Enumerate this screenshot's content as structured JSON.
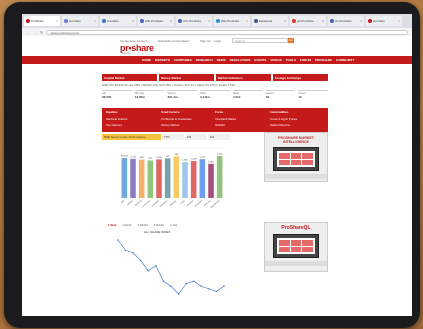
{
  "browser": {
    "tabs": [
      {
        "label": "ProShare",
        "favicon_color": "#c41a1a",
        "active": true
      },
      {
        "label": "proshare",
        "favicon_color": "#6a7bd0",
        "active": false
      },
      {
        "label": "proshare",
        "favicon_color": "#3a74c9",
        "active": false
      },
      {
        "label": "(39) Proshare",
        "favicon_color": "#3f65b8",
        "active": false
      },
      {
        "label": "(27) Proshare",
        "favicon_color": "#3f65b8",
        "active": false
      },
      {
        "label": "(50) Proshare",
        "favicon_color": "#2c8fd8",
        "active": false
      },
      {
        "label": "Facebook",
        "favicon_color": "#3b5998",
        "active": false
      },
      {
        "label": "(2) Proshare",
        "favicon_color": "#d93030",
        "active": false
      },
      {
        "label": "(1) Proshare",
        "favicon_color": "#3f65b8",
        "active": false
      },
      {
        "label": "proshare",
        "favicon_color": "#c41a1a",
        "active": false
      }
    ],
    "close_glyph": "×",
    "url": "www.proshareng.com"
  },
  "site": {
    "top_links": [
      "Create Free Account",
      "Subscribe to Newsletter",
      "Sign Up",
      "Login"
    ],
    "search_placeholder": "Search",
    "search_button": "Go",
    "logo": "pr•share",
    "logo_sub": "Nigeria",
    "nav": [
      "HOME",
      "MARKETS",
      "COMPANIES",
      "RESEARCH",
      "NEWS",
      "REGULATORS",
      "EVENTS",
      "VIDEOS",
      "TOOLS",
      "FORUM",
      "PROSHARE",
      "COMMUNITY"
    ]
  },
  "sub_blocks": [
    "Capital Market",
    "Money Market",
    "Market Indicators",
    "Foreign Exchange"
  ],
  "ticker": "NSE ASI 38,230.12 ▲0.45%  |  Market Cap N13.45tn  |  Volume 321.4m  |  Value N3.21bn  |  Deals 4,512",
  "mini_stats": [
    {
      "label": "ASI",
      "value": "38,230"
    },
    {
      "label": "Mkt Cap",
      "value": "13.45tn"
    },
    {
      "label": "Volume",
      "value": "321.4m"
    },
    {
      "label": "Value",
      "value": "3.21bn"
    },
    {
      "label": "Deals",
      "value": "4,512"
    },
    {
      "label": "Gainers",
      "value": "18"
    },
    {
      "label": "Losers",
      "value": "12"
    }
  ],
  "redbox": [
    {
      "text": "Equities",
      "h": true
    },
    {
      "text": "Fixed Income",
      "h": true
    },
    {
      "text": "Forex",
      "h": true
    },
    {
      "text": "Commodities",
      "h": true
    },
    {
      "text": "Sectoral Indices",
      "h": false
    },
    {
      "text": "FG Bonds & Treasuries",
      "h": false
    },
    {
      "text": "Interbank Rates",
      "h": false
    },
    {
      "text": "Crude & Agric Prices",
      "h": false
    },
    {
      "text": "Top Gainers",
      "h": false
    },
    {
      "text": "Money Market",
      "h": false
    },
    {
      "text": "NAFEX",
      "h": false
    },
    {
      "text": "Market Reports",
      "h": false
    }
  ],
  "bar_head": [
    "NSE Sector Index Performance",
    "YTD",
    "1W",
    "1M"
  ],
  "chart_data": {
    "type": "bar",
    "categories": [
      "ASI",
      "NSE30",
      "Banking",
      "Consumer",
      "Industrial",
      "Insurance",
      "Oil&Gas",
      "Lotus",
      "Pension",
      "Premium",
      "AFR Div",
      "Main Board"
    ],
    "values": [
      2.4,
      2.35,
      2.3,
      2.25,
      2.32,
      2.38,
      2.5,
      2.15,
      2.22,
      2.33,
      2.05,
      2.52
    ],
    "colors": [
      "#6fa8dc",
      "#8e7cc3",
      "#f6b26b",
      "#93c47d",
      "#e06666",
      "#76a5af",
      "#f9cb66",
      "#9fc5e8",
      "#e06666",
      "#6d9eeb",
      "#a64d79",
      "#93c47d"
    ],
    "ylim": [
      0,
      3
    ],
    "data_labels": [
      "38,230",
      "1,709",
      "408",
      "612",
      "1,205",
      "152",
      "286",
      "1,934",
      "1,018",
      "2,145",
      "1,312",
      "1,902"
    ]
  },
  "line_tabs": [
    "1 Week",
    "1 Month",
    "3 Months",
    "6 Months",
    "1 Year"
  ],
  "line_chart": {
    "title": "ALL SHARE INDEX",
    "values": [
      38.5,
      38.3,
      38.25,
      38.1,
      37.9,
      38.0,
      37.7,
      37.6,
      37.45,
      37.65,
      37.7,
      37.6,
      37.55,
      37.5,
      37.6
    ]
  },
  "ads": {
    "ad1_title": "PROSHARE MARKET\nINTELLIGENCE",
    "ad2_logo": "ProShareQL"
  }
}
